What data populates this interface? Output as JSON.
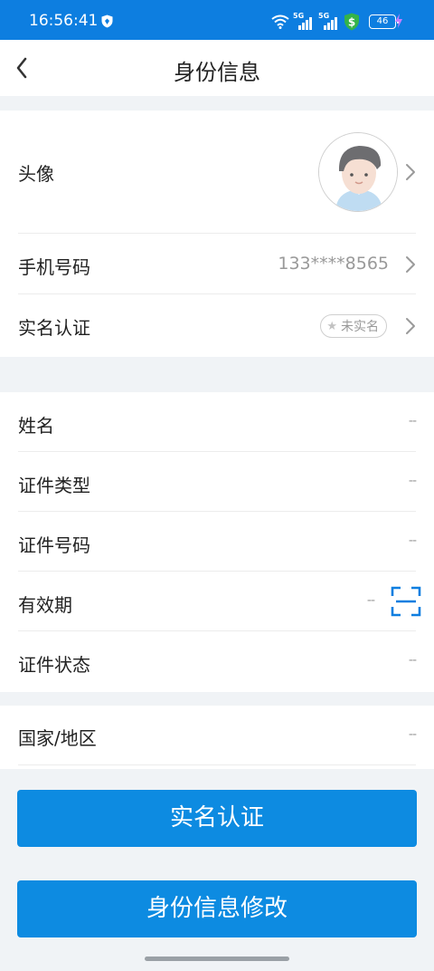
{
  "status_bar": {
    "time": "16:56:41",
    "battery": "46",
    "network_1": "5G",
    "network_2": "5G",
    "icons": [
      "shield-icon",
      "wifi-icon",
      "signal-icon",
      "signal-icon",
      "security-dollar-icon",
      "battery-icon",
      "charging-bolt-icon"
    ]
  },
  "header": {
    "title": "身份信息",
    "back_icon": "chevron-left-icon"
  },
  "account": {
    "avatar_label": "头像",
    "phone_label": "手机号码",
    "phone_value": "133****8565",
    "realname_label": "实名认证",
    "realname_status": "未实名"
  },
  "identity": {
    "name_label": "姓名",
    "name_value": "--",
    "id_type_label": "证件类型",
    "id_type_value": "--",
    "id_number_label": "证件号码",
    "id_number_value": "--",
    "validity_label": "有效期",
    "validity_value": "--",
    "id_status_label": "证件状态",
    "id_status_value": "--"
  },
  "region": {
    "label": "国家/地区",
    "value": "--"
  },
  "buttons": {
    "verify": "实名认证",
    "modify": "身份信息修改"
  },
  "colors": {
    "primary": "#0d8be1",
    "status_bar": "#0d7ee0",
    "background": "#f0f3f6"
  }
}
